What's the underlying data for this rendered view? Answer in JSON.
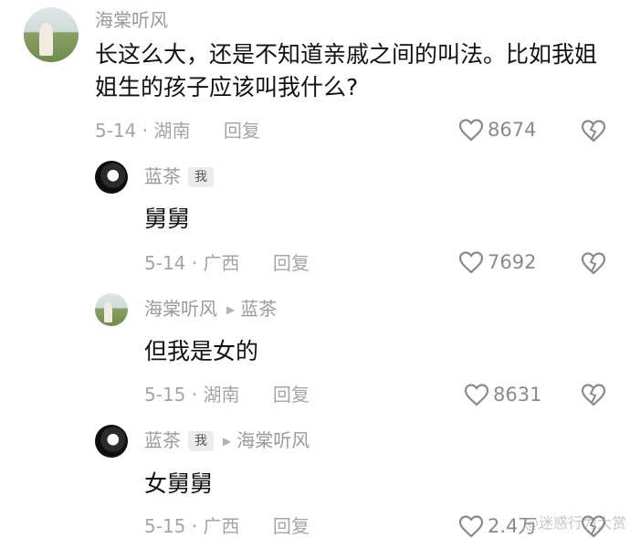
{
  "comments": [
    {
      "author": "海棠听风",
      "text": "长这么大，还是不知道亲戚之间的叫法。比如我姐姐生的孩子应该叫我什么?",
      "date": "5-14",
      "location": "湖南",
      "reply_label": "回复",
      "likes": "8674"
    },
    {
      "author": "蓝茶",
      "author_tag": "我",
      "text": "舅舅",
      "date": "5-14",
      "location": "广西",
      "reply_label": "回复",
      "likes": "7692"
    },
    {
      "author": "海棠听风",
      "reply_to": "蓝茶",
      "text": "但我是女的",
      "date": "5-15",
      "location": "湖南",
      "reply_label": "回复",
      "likes": "8631"
    },
    {
      "author": "蓝茶",
      "author_tag": "我",
      "reply_to": "海棠听风",
      "text": "女舅舅",
      "date": "5-15",
      "location": "广西",
      "reply_label": "回复",
      "likes": "2.4万"
    }
  ],
  "watermark": "@迷惑行为大赏",
  "icons": {
    "like": "heart-outline-icon",
    "dislike": "broken-heart-icon",
    "reply_arrow": "triangle-right-icon"
  },
  "colors": {
    "text": "#111111",
    "meta": "#a4a4a4",
    "tag_bg": "#ececec"
  }
}
